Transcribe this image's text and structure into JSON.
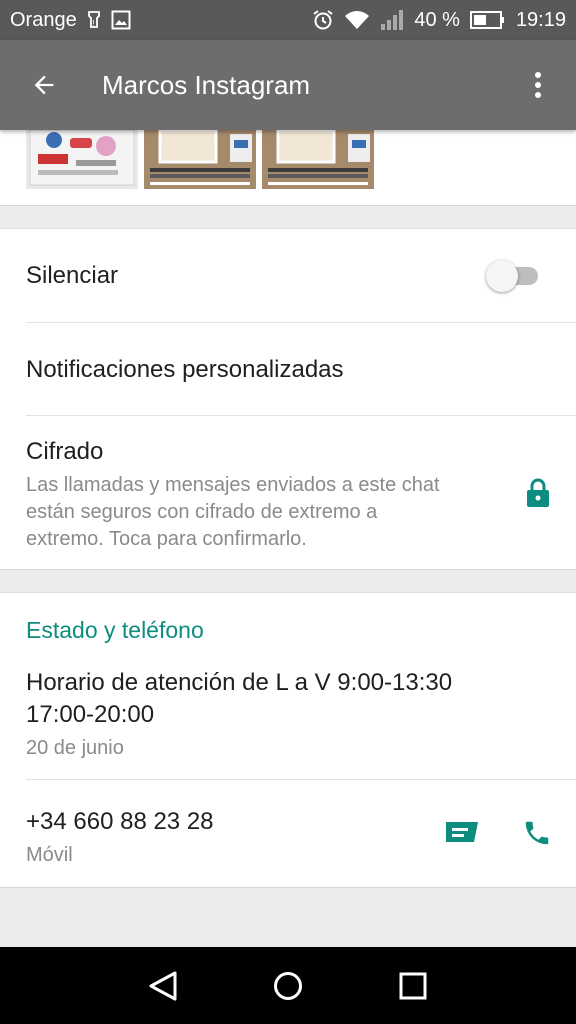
{
  "status_bar": {
    "carrier": "Orange",
    "battery_percent": "40 %",
    "time": "19:19",
    "icons": [
      "notification-icon",
      "image-icon",
      "alarm-icon",
      "wifi-icon",
      "signal-icon",
      "battery-icon"
    ]
  },
  "app_bar": {
    "title": "Marcos Instagram",
    "back_icon": "arrow-back-icon",
    "menu_icon": "more-vert-icon"
  },
  "settings": {
    "mute_label": "Silenciar",
    "mute_on": false,
    "custom_notifications_label": "Notificaciones personalizadas",
    "encryption_title": "Cifrado",
    "encryption_desc_1": "Las llamadas y mensajes enviados a este chat",
    "encryption_desc_2": "están seguros con cifrado de extremo a",
    "encryption_desc_3": "extremo. Toca para confirmarlo."
  },
  "about": {
    "header": "Estado y teléfono",
    "status_line_1": "Horario de atención de L a V 9:00-13:30",
    "status_line_2": "17:00-20:00",
    "status_date": "20 de junio",
    "phone": "+34 660 88 23 28",
    "phone_type": "Móvil"
  },
  "colors": {
    "accent": "#0d8d7f",
    "appbar": "#6d6d6d",
    "statusbar": "#595959"
  },
  "nav_bar": [
    "back-triangle-icon",
    "home-circle-icon",
    "recents-square-icon"
  ]
}
